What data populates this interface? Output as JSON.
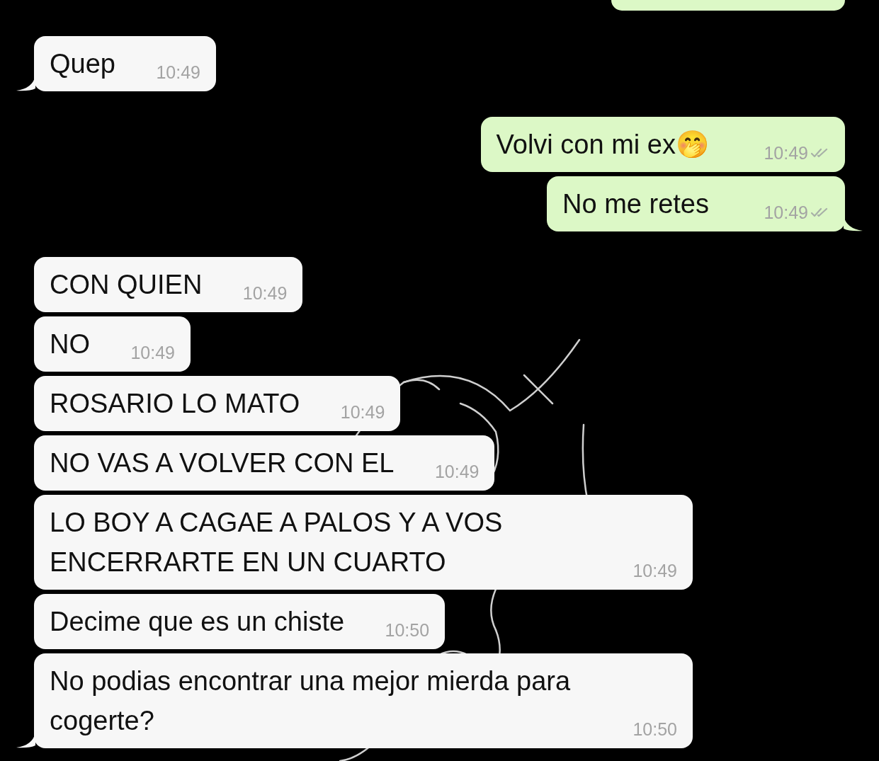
{
  "messages": [
    {
      "kind": "clipped",
      "outgoing": true
    },
    {
      "kind": "text",
      "outgoing": false,
      "text": "Quep",
      "time": "10:49",
      "tail": true
    },
    {
      "kind": "text",
      "outgoing": true,
      "text": "Volvi con mi ex🤭",
      "time": "10:49",
      "tail": false,
      "read": false
    },
    {
      "kind": "text",
      "outgoing": true,
      "text": "No me retes",
      "time": "10:49",
      "tail": true,
      "read": false
    },
    {
      "kind": "text",
      "outgoing": false,
      "text": "CON QUIEN",
      "time": "10:49",
      "tail": false
    },
    {
      "kind": "text",
      "outgoing": false,
      "text": "NO",
      "time": "10:49",
      "tail": false
    },
    {
      "kind": "text",
      "outgoing": false,
      "text": "ROSARIO LO MATO",
      "time": "10:49",
      "tail": false
    },
    {
      "kind": "text",
      "outgoing": false,
      "text": "NO VAS A VOLVER CON EL",
      "time": "10:49",
      "tail": false
    },
    {
      "kind": "text",
      "outgoing": false,
      "text": "LO BOY A CAGAE A PALOS Y A VOS ENCERRARTE EN UN CUARTO",
      "time": "10:49",
      "tail": false
    },
    {
      "kind": "text",
      "outgoing": false,
      "text": "Decime que es un chiste",
      "time": "10:50",
      "tail": false
    },
    {
      "kind": "text",
      "outgoing": false,
      "text": "No podias encontrar una mejor mierda para cogerte?",
      "time": "10:50",
      "tail": true
    }
  ]
}
